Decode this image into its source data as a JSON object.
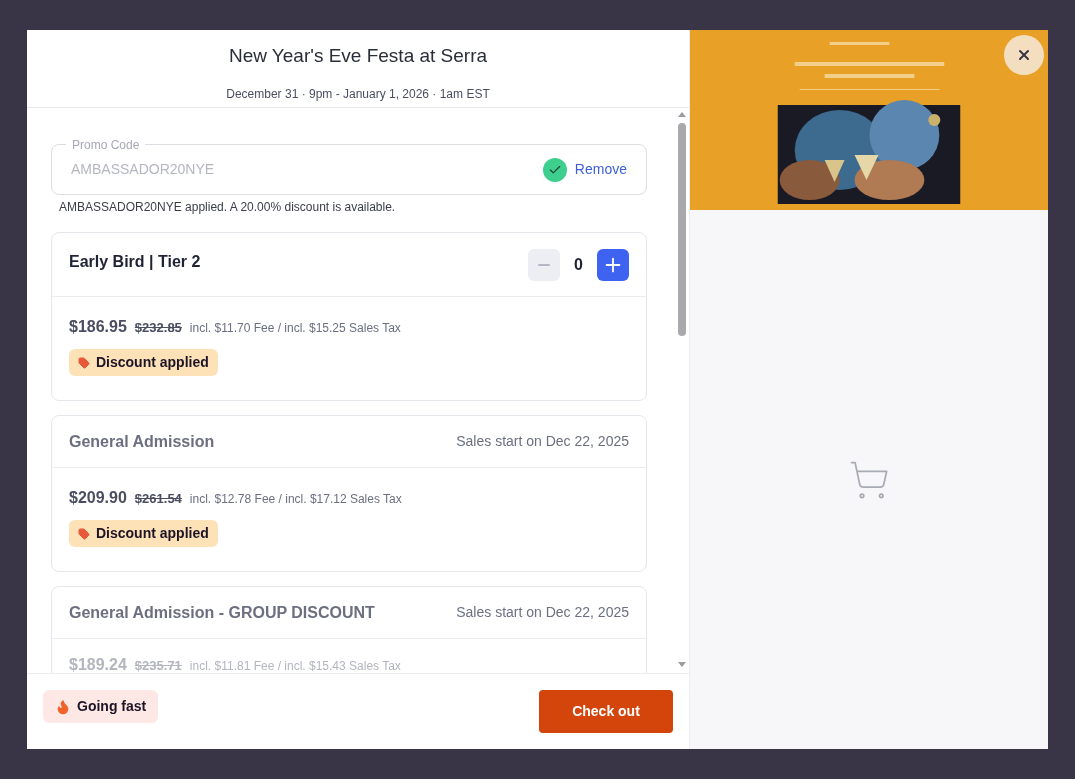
{
  "event": {
    "title": "New Year's Eve Festa at Serra",
    "date": "December 31 · 9pm - January 1, 2026 · 1am EST"
  },
  "promo": {
    "label": "Promo Code",
    "value": "AMBASSADOR20NYE",
    "applied": true,
    "action": "Remove",
    "message": "AMBASSADOR20NYE applied. A 20.00% discount is available."
  },
  "tickets": [
    {
      "kind": "stepper",
      "name": "Early Bird | Tier 2",
      "available": true,
      "quantity": "0",
      "minus_disabled": true,
      "price": "$186.95",
      "original_price": "$232.85",
      "fees": "incl. $11.70 Fee / incl. $15.25 Sales Tax",
      "badge": "Discount applied",
      "dimmed": false
    },
    {
      "kind": "scheduled",
      "name": "General Admission",
      "available": false,
      "sales_start": "Sales start on Dec 22, 2025",
      "price": "$209.90",
      "original_price": "$261.54",
      "fees": "incl. $12.78 Fee / incl. $17.12 Sales Tax",
      "badge": "Discount applied",
      "dimmed": false
    },
    {
      "kind": "scheduled",
      "name": "General Admission - GROUP DISCOUNT",
      "available": false,
      "sales_start": "Sales start on Dec 22, 2025",
      "price": "$189.24",
      "original_price": "$235.71",
      "fees": "incl. $11.81 Fee / incl. $15.43 Sales Tax",
      "dimmed": true
    }
  ],
  "footer": {
    "badge": "Going fast",
    "checkout": "Check out"
  }
}
